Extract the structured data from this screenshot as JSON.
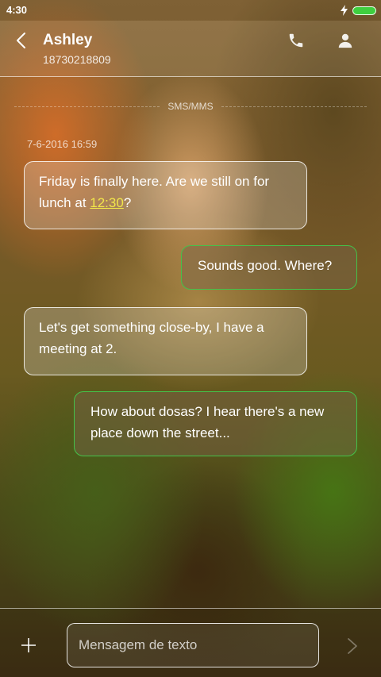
{
  "status_bar": {
    "time": "4:30",
    "battery_color": "#3fcf3f"
  },
  "header": {
    "contact_name": "Ashley",
    "contact_number": "18730218809",
    "icons": [
      "back-icon",
      "phone-icon",
      "profile-icon"
    ]
  },
  "conversation": {
    "channel_label": "SMS/MMS",
    "timestamp": "7-6-2016 16:59",
    "messages": [
      {
        "direction": "incoming",
        "text_before": "Friday is finally here. Are we still on for lunch at ",
        "link": "12:30",
        "text_after": "?"
      },
      {
        "direction": "outgoing",
        "text": "Sounds good. Where?"
      },
      {
        "direction": "incoming",
        "text": "Let's get something close-by, I have a meeting at 2."
      },
      {
        "direction": "outgoing",
        "text": "How about dosas? I hear there's a new place down the street..."
      }
    ]
  },
  "composer": {
    "placeholder": "Mensagem de texto",
    "value": ""
  },
  "colors": {
    "outgoing_border": "#44c24a",
    "link": "#f2e64a"
  }
}
